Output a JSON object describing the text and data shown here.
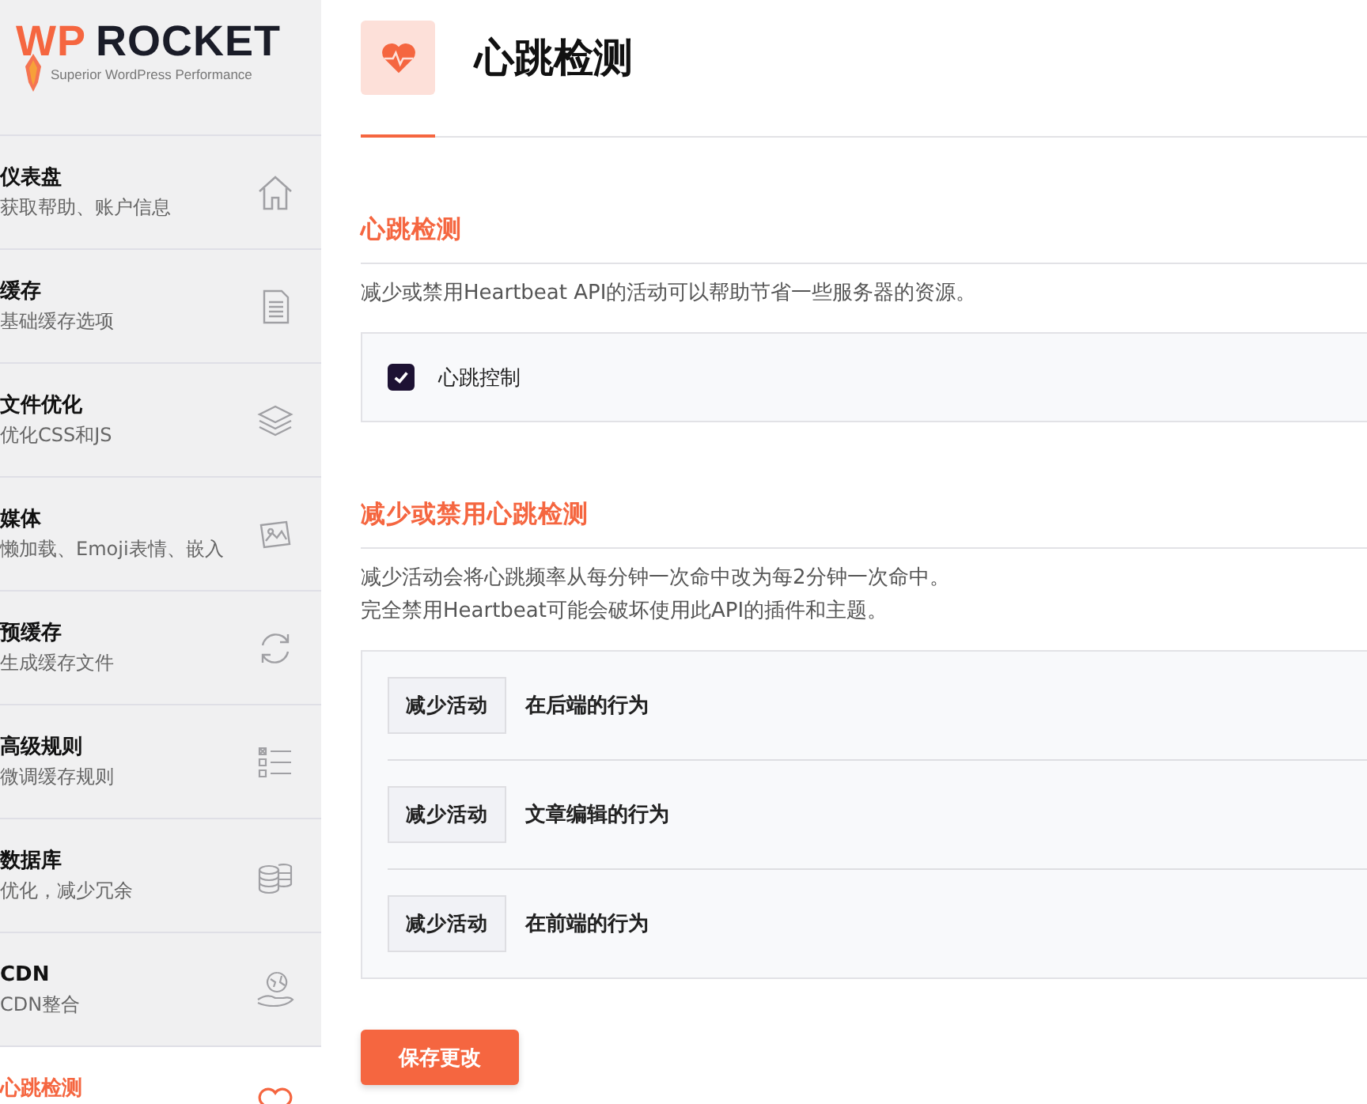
{
  "logo": {
    "brand_left": "WP",
    "brand_right": "ROCKET",
    "tagline": "Superior WordPress Performance"
  },
  "sidebar": {
    "items": [
      {
        "title": "仪表盘",
        "subtitle": "获取帮助、账户信息",
        "selected": false
      },
      {
        "title": "缓存",
        "subtitle": "基础缓存选项",
        "selected": false
      },
      {
        "title": "文件优化",
        "subtitle": "优化CSS和JS",
        "selected": false
      },
      {
        "title": "媒体",
        "subtitle": "懒加载、Emoji表情、嵌入",
        "selected": false
      },
      {
        "title": "预缓存",
        "subtitle": "生成缓存文件",
        "selected": false
      },
      {
        "title": "高级规则",
        "subtitle": "微调缓存规则",
        "selected": false
      },
      {
        "title": "数据库",
        "subtitle": "优化，减少冗余",
        "selected": false
      },
      {
        "title": "CDN",
        "subtitle": "CDN整合",
        "selected": false
      },
      {
        "title": "心跳检测",
        "selected": true
      }
    ]
  },
  "page": {
    "title": "心跳检测"
  },
  "sections": [
    {
      "title": "心跳检测",
      "description": [
        "减少或禁用Heartbeat API的活动可以帮助节省一些服务器的资源。"
      ],
      "options": [
        {
          "kind": "checkbox",
          "label": "心跳控制",
          "checked": true
        }
      ]
    },
    {
      "title": "减少或禁用心跳检测",
      "description": [
        "减少活动会将心跳频率从每分钟一次命中改为每2分钟一次命中。",
        "完全禁用Heartbeat可能会破坏使用此API的插件和主题。"
      ],
      "options": [
        {
          "kind": "select",
          "value": "减少活动",
          "label": "在后端的行为"
        },
        {
          "kind": "select",
          "value": "减少活动",
          "label": "文章编辑的行为"
        },
        {
          "kind": "select",
          "value": "减少活动",
          "label": "在前端的行为"
        }
      ]
    }
  ],
  "save_button": "保存更改"
}
